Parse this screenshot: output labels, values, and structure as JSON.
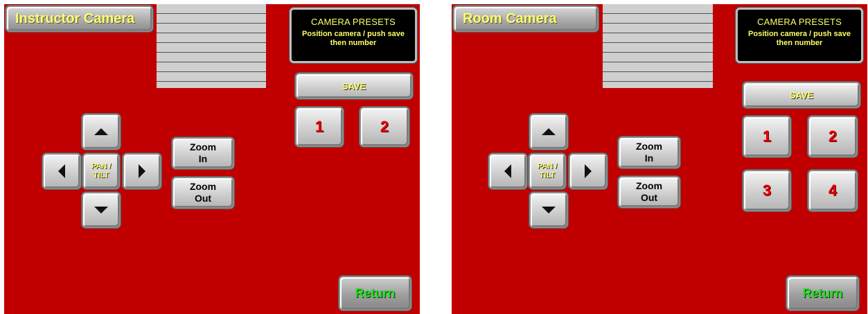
{
  "panels": [
    {
      "title": "Instructor Camera",
      "presets": {
        "title": "CAMERA PRESETS",
        "instruction": "Position camera / push save then number",
        "save_label": "SAVE",
        "numbers": [
          "1",
          "2"
        ]
      },
      "pan_tilt_label": "PAN / TILT",
      "zoom_in_label": "Zoom In",
      "zoom_out_label": "Zoom Out",
      "return_label": "Return",
      "icons": {
        "up": "arrow-up-icon",
        "down": "arrow-down-icon",
        "left": "arrow-left-icon",
        "right": "arrow-right-icon"
      }
    },
    {
      "title": "Room Camera",
      "presets": {
        "title": "CAMERA PRESETS",
        "instruction": "Position camera / push save then number",
        "save_label": "SAVE",
        "numbers": [
          "1",
          "2",
          "3",
          "4"
        ]
      },
      "pan_tilt_label": "PAN / TILT",
      "zoom_in_label": "Zoom In",
      "zoom_out_label": "Zoom Out",
      "return_label": "Return",
      "icons": {
        "up": "arrow-up-icon",
        "down": "arrow-down-icon",
        "left": "arrow-left-icon",
        "right": "arrow-right-icon"
      }
    }
  ],
  "colors": {
    "background": "#c00000",
    "title_text": "#ffff66",
    "preset_number": "#e00000",
    "return_text": "#22dd22"
  }
}
